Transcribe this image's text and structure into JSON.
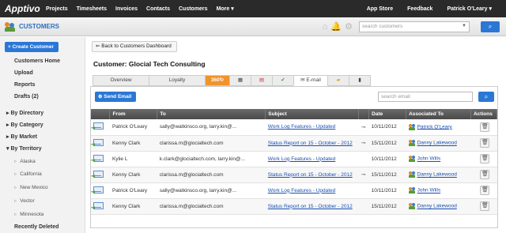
{
  "topnav": {
    "logo": "Apptivo",
    "items": [
      "Projects",
      "Timesheets",
      "Invoices",
      "Contacts",
      "Customers",
      "More ▾"
    ],
    "right": [
      "App Store",
      "Feedback",
      "Patrick O'Leary ▾"
    ]
  },
  "module": {
    "title": "CUSTOMERS",
    "search_placeholder": "search customers",
    "icons": [
      "home-icon",
      "bell-icon",
      "gear-icon",
      "chevron-down-icon",
      "search-icon"
    ]
  },
  "sidebar": {
    "create": "+ Create Customer",
    "links": [
      "Customers Home",
      "Upload",
      "Reports",
      "Drafts (2)"
    ],
    "groups": [
      "By Directory",
      "By Category",
      "By Market",
      "By Territory"
    ],
    "territories": [
      "Alaska",
      "California",
      "New Mexico",
      "Vector",
      "Minnesota"
    ],
    "recently_deleted": "Recently Deleted"
  },
  "main": {
    "back": "Back to Customers Dashboard",
    "customer_title": "Customer: Glocial Tech Consulting",
    "tabs": [
      "Overview",
      "Loyalty",
      "360",
      "",
      "",
      "",
      "E-mail",
      "",
      ""
    ],
    "send_email": "Send Email",
    "search_email_placeholder": "search email",
    "columns": [
      "From",
      "To",
      "Subject",
      "",
      "Date",
      "Associated To",
      "Actions"
    ],
    "rows": [
      {
        "from": "Patrick O'Leary",
        "to": "sally@watkinsco.org, larry.kin@...",
        "subject": "Work Log Features - Updated",
        "clip": true,
        "date": "10/11/2012",
        "assoc": "Patrick O'Leary"
      },
      {
        "from": "Kenny Clark",
        "to": "clarissa.m@glocialtech.com",
        "subject": "Status Report on 15 - October - 2012",
        "clip": true,
        "date": "15/11/2012",
        "assoc": "Danny Lakewood"
      },
      {
        "from": "Kylie L",
        "to": "k.clark@glocialtech.com, larry.kin@...",
        "subject": "Work Log Features - Updated",
        "clip": false,
        "date": "10/11/2012",
        "assoc": "John Wills"
      },
      {
        "from": "Kenny Clark",
        "to": "clarissa.m@glocialtech.com",
        "subject": "Status Report on 15 - October - 2012",
        "clip": true,
        "date": "15/11/2012",
        "assoc": "Danny Lakewood"
      },
      {
        "from": "Patrick O'Leary",
        "to": "sally@watkinsco.org, larry.kin@...",
        "subject": "Work Log Features - Updated",
        "clip": false,
        "date": "10/11/2012",
        "assoc": "John Wills"
      },
      {
        "from": "Kenny Clark",
        "to": "clarissa.m@glocialtech.com",
        "subject": "Status Report on 15 - October - 2012",
        "clip": false,
        "date": "15/11/2012",
        "assoc": "Danny Lakewood"
      }
    ]
  },
  "colors": {
    "accent": "#2b77d6",
    "nav_bg": "#2a2a2a",
    "tab_360": "#f0932b"
  }
}
